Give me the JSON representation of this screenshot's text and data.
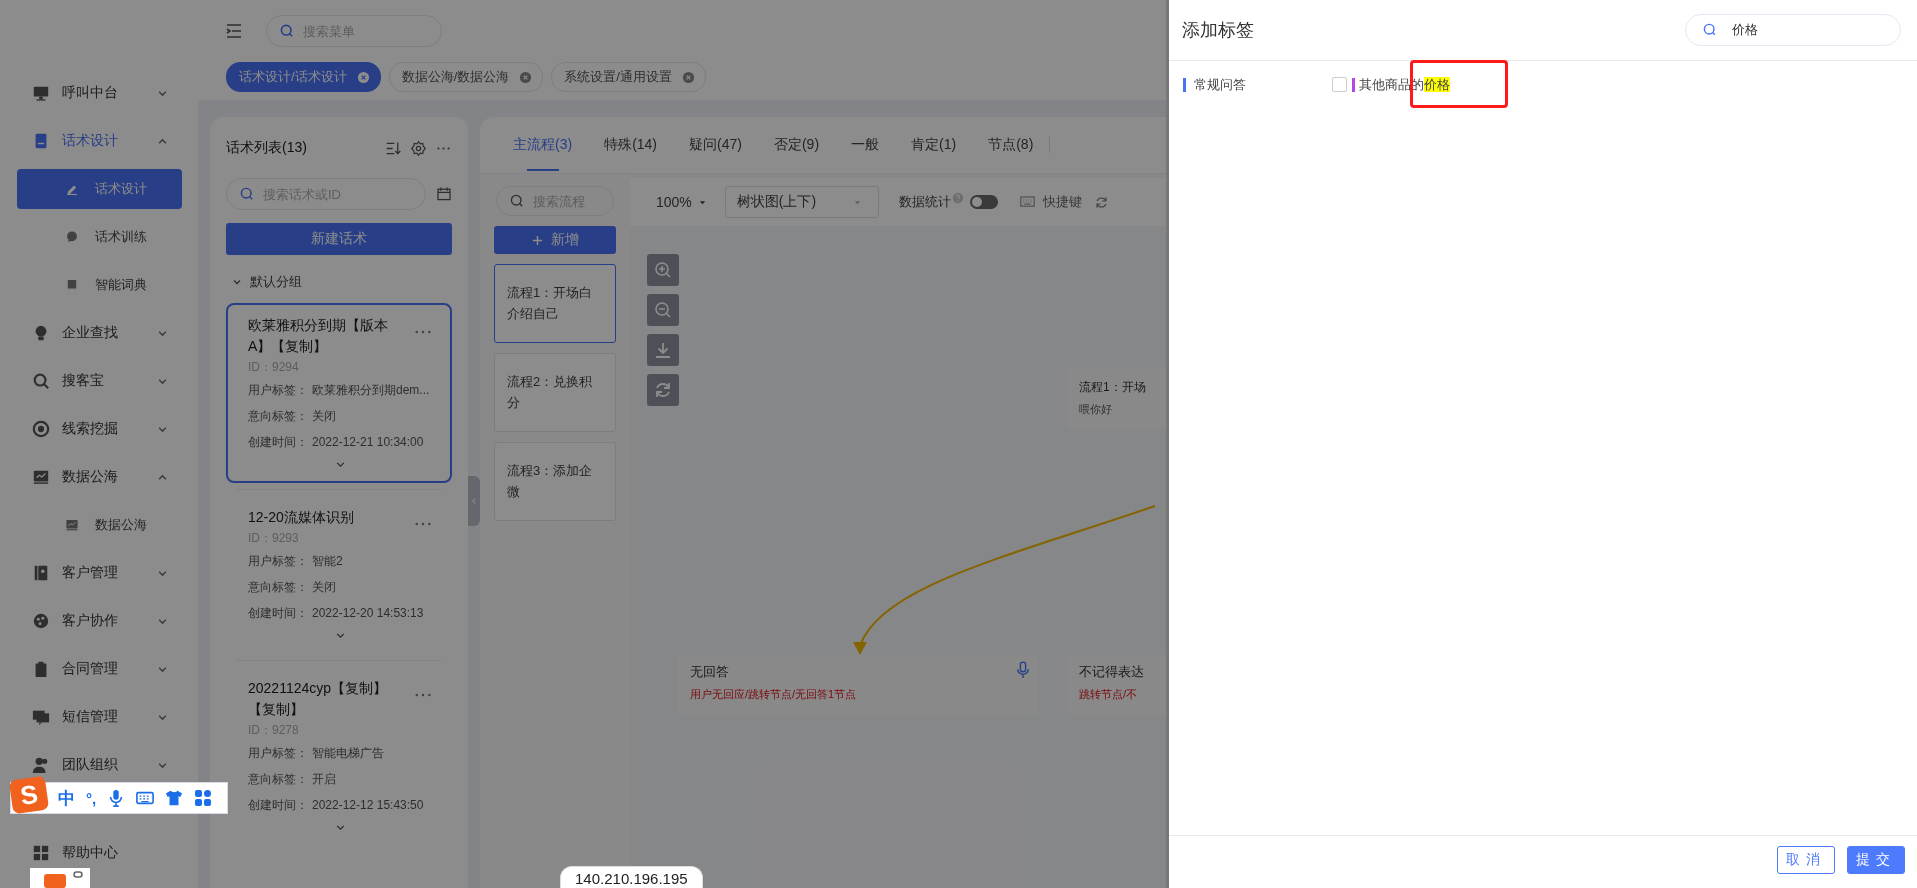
{
  "sidebar": {
    "items": [
      {
        "label": "呼叫中台",
        "kind": "group",
        "expanded": false,
        "selected": false
      },
      {
        "label": "话术设计",
        "kind": "group",
        "expanded": true,
        "selected": true,
        "children": [
          {
            "label": "话术设计",
            "selected": true
          },
          {
            "label": "话术训练",
            "selected": false
          },
          {
            "label": "智能词典",
            "selected": false
          }
        ]
      },
      {
        "label": "企业查找",
        "kind": "group",
        "expanded": false,
        "selected": false
      },
      {
        "label": "搜客宝",
        "kind": "group",
        "expanded": false,
        "selected": false
      },
      {
        "label": "线索挖掘",
        "kind": "group",
        "expanded": false,
        "selected": false
      },
      {
        "label": "数据公海",
        "kind": "group",
        "expanded": true,
        "selected": false,
        "children": [
          {
            "label": "数据公海",
            "selected": false
          }
        ]
      },
      {
        "label": "客户管理",
        "kind": "group",
        "expanded": false,
        "selected": false
      },
      {
        "label": "客户协作",
        "kind": "group",
        "expanded": false,
        "selected": false
      },
      {
        "label": "合同管理",
        "kind": "group",
        "expanded": false,
        "selected": false
      },
      {
        "label": "短信管理",
        "kind": "group",
        "expanded": false,
        "selected": false
      },
      {
        "label": "团队组织",
        "kind": "group",
        "expanded": false,
        "selected": false
      },
      {
        "label": "帮助中心",
        "kind": "link",
        "expanded": false,
        "selected": false
      }
    ]
  },
  "top_bar": {
    "search": {
      "placeholder": "搜索菜单"
    },
    "tabs": [
      {
        "label": "话术设计/话术设计",
        "selected": true
      },
      {
        "label": "数据公海/数据公海",
        "selected": false
      },
      {
        "label": "系统设置/通用设置",
        "selected": false
      }
    ]
  },
  "script_list": {
    "title": "话术列表(13)",
    "search": {
      "placeholder": "搜索话术或ID"
    },
    "new_button": "新建话术",
    "group": {
      "label": "默认分组",
      "expanded": true
    },
    "cards": [
      {
        "title": "欧莱雅积分到期【版本A】【复制】",
        "id": "ID：9294",
        "selected": true,
        "fields": [
          {
            "label": "用户标签：",
            "value": "欧莱雅积分到期dem..."
          },
          {
            "label": "意向标签：",
            "value": "关闭"
          },
          {
            "label": "创建时间：",
            "value": "2022-12-21 10:34:00"
          }
        ]
      },
      {
        "title": "12-20流媒体识别",
        "id": "ID：9293",
        "selected": false,
        "fields": [
          {
            "label": "用户标签：",
            "value": "智能2"
          },
          {
            "label": "意向标签：",
            "value": "关闭"
          },
          {
            "label": "创建时间：",
            "value": "2022-12-20 14:53:13"
          }
        ]
      },
      {
        "title": "20221124cyp【复制】【复制】",
        "id": "ID：9278",
        "selected": false,
        "fields": [
          {
            "label": "用户标签：",
            "value": "智能电梯广告"
          },
          {
            "label": "意向标签：",
            "value": "开启"
          },
          {
            "label": "创建时间：",
            "value": "2022-12-12 15:43:50"
          }
        ]
      }
    ]
  },
  "flow_panel": {
    "tabs": [
      {
        "label": "主流程(3)",
        "selected": true
      },
      {
        "label": "特殊(14)",
        "selected": false
      },
      {
        "label": "疑问(47)",
        "selected": false
      },
      {
        "label": "否定(9)",
        "selected": false
      },
      {
        "label": "一般",
        "selected": false
      },
      {
        "label": "肯定(1)",
        "selected": false
      },
      {
        "label": "节点(8)",
        "selected": false
      }
    ],
    "search": {
      "placeholder": "搜索流程"
    },
    "add_button": "新增",
    "flows": [
      {
        "label": "流程1：开场白介绍自己",
        "selected": true
      },
      {
        "label": "流程2：兑换积分",
        "selected": false
      },
      {
        "label": "流程3：添加企微",
        "selected": false
      }
    ],
    "toolbar": {
      "zoom": "100%",
      "layout": "树状图(上下)",
      "stats_label": "数据统计",
      "stats_on": false,
      "shortcut": "快捷键"
    },
    "nodes": [
      {
        "kind": "flow",
        "title": "流程1：开场",
        "subtitle": "喂你好"
      },
      {
        "kind": "branch",
        "title": "无回答",
        "subtitle": "用户无回应/跳转节点/无回答1节点"
      },
      {
        "kind": "branch",
        "title": "不记得表达",
        "subtitle": "跳转节点/不"
      }
    ]
  },
  "drawer": {
    "title": "添加标签",
    "search": {
      "value": "价格"
    },
    "categories": [
      {
        "name": "常规问答",
        "tags": [
          {
            "text": "其他商品的",
            "match": "价格",
            "checked": false
          }
        ]
      }
    ],
    "cancel": "取消",
    "submit": "提交"
  },
  "ime_bar": {
    "logo": "S",
    "mode": "中",
    "punctuation": "°,"
  },
  "ip_badge": "140.210.196.195"
}
